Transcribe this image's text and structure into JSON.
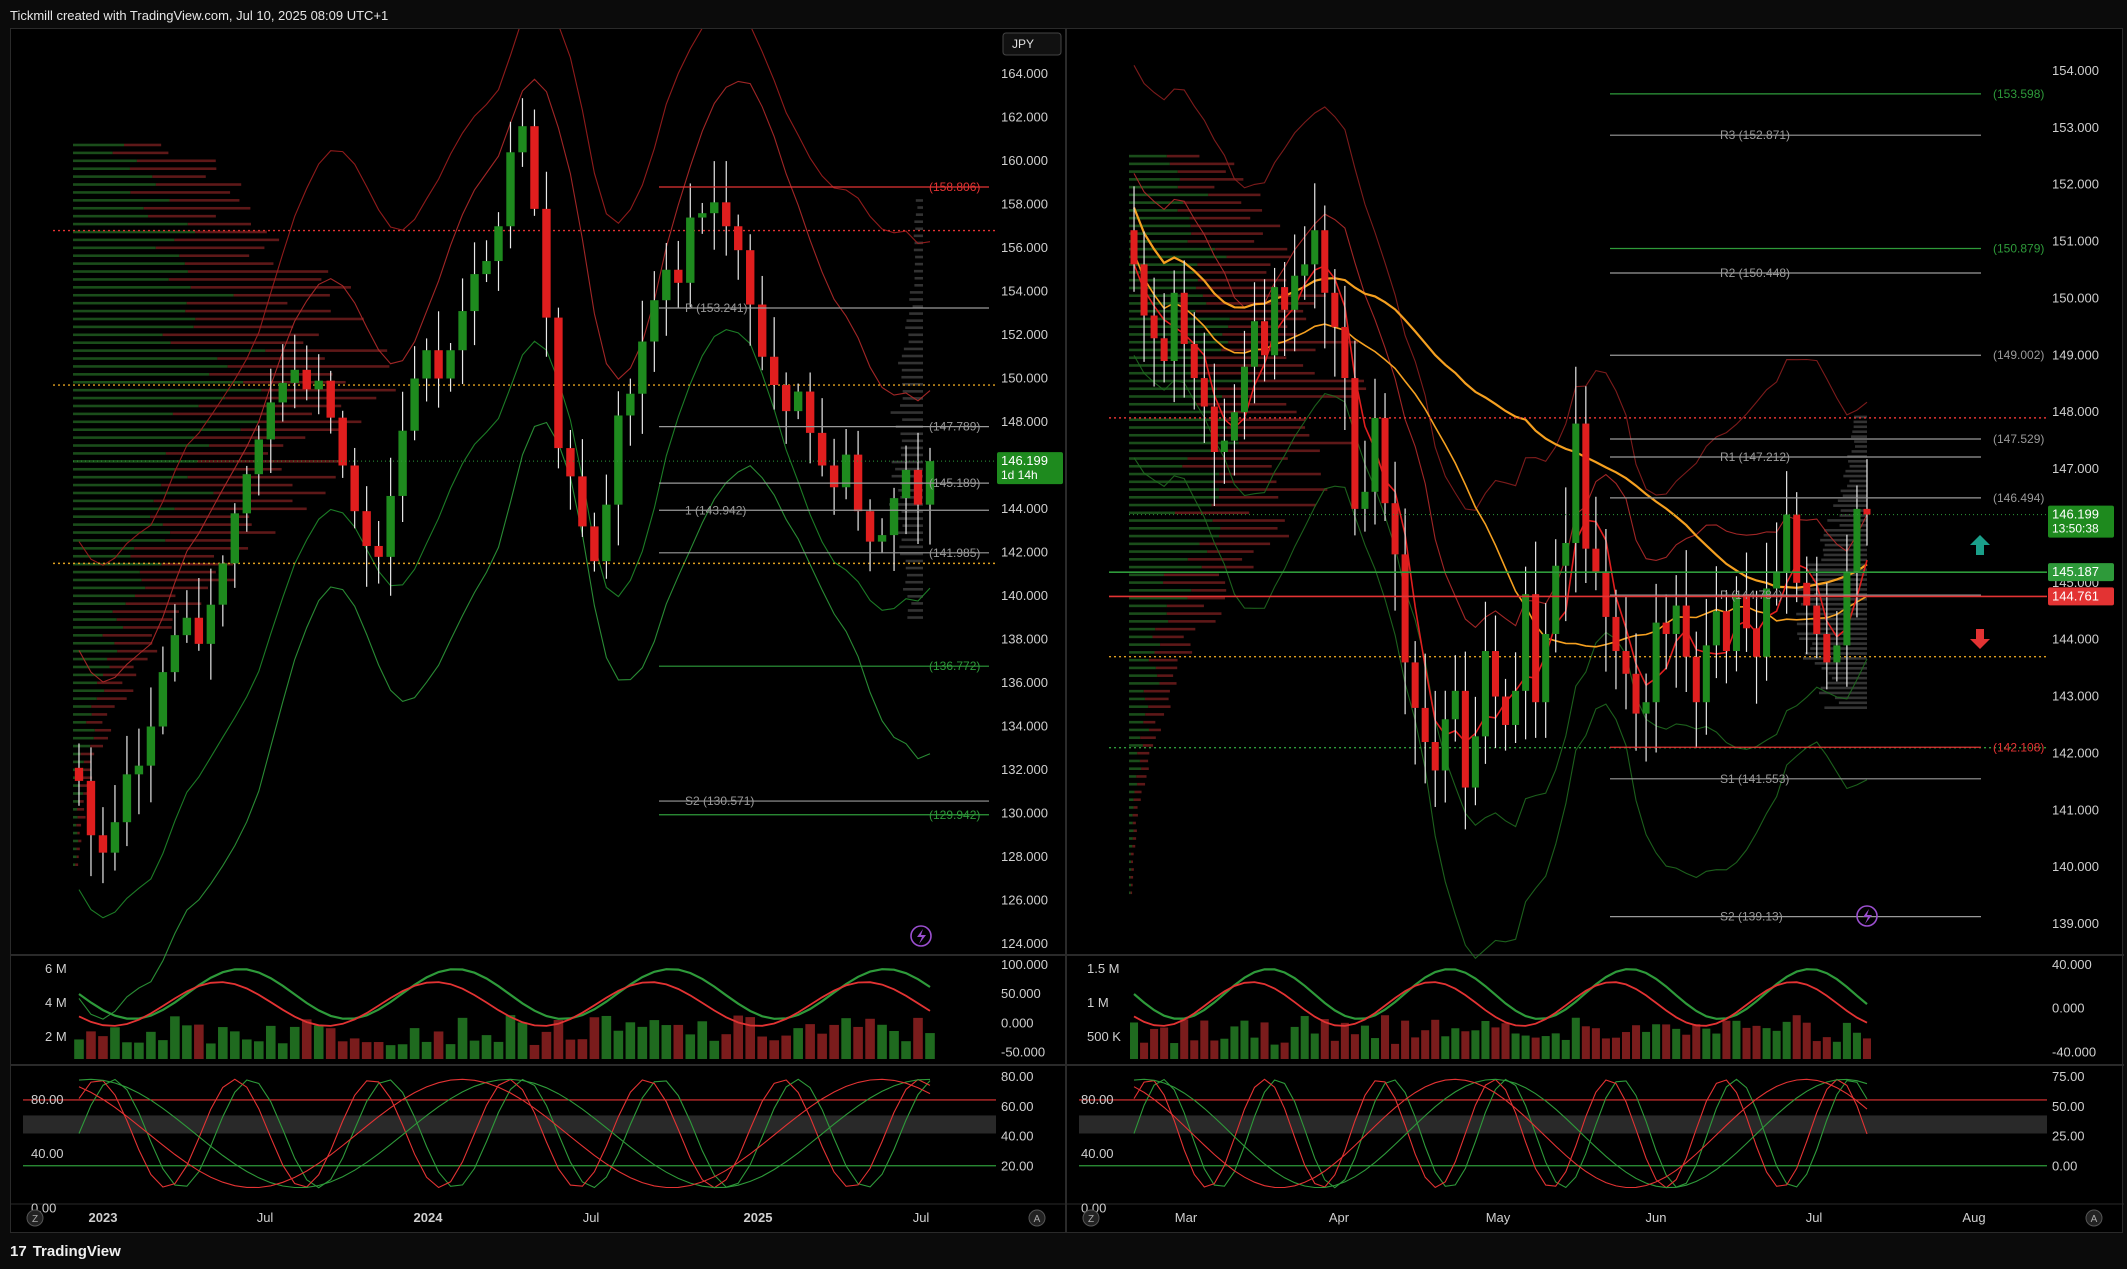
{
  "header": {
    "caption": "Tickmill created with TradingView.com, Jul 10, 2025 08:09 UTC+1"
  },
  "footer": {
    "brand": "TradingView"
  },
  "colors": {
    "up": "#1e8a1e",
    "down": "#e01e1e",
    "background": "#000000",
    "grid": "#1a1a1a",
    "pivot_line": "#9a9a9a",
    "support_green": "#2e9a3a",
    "resistance_red": "#e33333",
    "poc_dotted": "#e0a020",
    "ma_orange": "#f5a020"
  },
  "chart_data": [
    {
      "id": "weekly",
      "type": "candlestick",
      "currency_badge": "JPY",
      "yaxis": {
        "min": 124.0,
        "max": 164.0,
        "ticks": [
          "164.000",
          "162.000",
          "160.000",
          "158.000",
          "156.000",
          "154.000",
          "152.000",
          "150.000",
          "148.000",
          "146.000",
          "144.000",
          "142.000",
          "140.000",
          "138.000",
          "136.000",
          "134.000",
          "132.000",
          "130.000",
          "128.000",
          "126.000",
          "124.000"
        ]
      },
      "xaxis": {
        "ticks": [
          "2023",
          "Jul",
          "2024",
          "Jul",
          "2025",
          "Jul"
        ],
        "bold": [
          "2023",
          "2024",
          "2025"
        ]
      },
      "last_price": {
        "value": "146.199",
        "countdown": "1d 14h"
      },
      "levels": [
        {
          "label": "(158.806)",
          "value": 158.806,
          "kind": "red"
        },
        {
          "label": "P (153.241)",
          "value": 153.241,
          "kind": "pivot"
        },
        {
          "label": "(147.789)",
          "value": 147.789,
          "kind": "pivot"
        },
        {
          "label": "(145.189)",
          "value": 145.189,
          "kind": "pivot"
        },
        {
          "label": "1 (143.942)",
          "value": 143.942,
          "kind": "pivot"
        },
        {
          "label": "(141.985)",
          "value": 141.985,
          "kind": "pivot"
        },
        {
          "label": "(136.772)",
          "value": 136.772,
          "kind": "green"
        },
        {
          "label": "S2 (130.571)",
          "value": 130.571,
          "kind": "pivot"
        },
        {
          "label": "(129.942)",
          "value": 129.942,
          "kind": "green"
        }
      ],
      "horizontal_dotted": [
        {
          "value": 156.8,
          "color": "red"
        },
        {
          "value": 149.7,
          "color": "orange"
        },
        {
          "value": 141.5,
          "color": "orange"
        }
      ],
      "closes": [
        131.5,
        129.0,
        128.2,
        129.6,
        131.8,
        132.2,
        134.0,
        136.5,
        138.2,
        139.0,
        137.8,
        139.6,
        141.5,
        143.8,
        145.6,
        147.2,
        148.9,
        149.8,
        150.4,
        149.5,
        149.9,
        148.2,
        146.0,
        143.9,
        142.3,
        141.8,
        144.6,
        147.6,
        150.0,
        151.3,
        150.0,
        151.3,
        153.1,
        154.8,
        155.4,
        157.0,
        160.4,
        161.6,
        157.8,
        152.8,
        146.8,
        145.5,
        143.2,
        141.6,
        144.2,
        148.3,
        149.3,
        151.7,
        153.6,
        155.0,
        154.4,
        157.4,
        157.6,
        158.1,
        157.0,
        155.9,
        153.4,
        151.0,
        149.7,
        148.5,
        149.4,
        147.5,
        146.0,
        145.0,
        146.5,
        143.9,
        142.5,
        142.8,
        144.5,
        145.8,
        144.2,
        146.2
      ],
      "volume": {
        "ticks": [
          "6 M",
          "4 M",
          "2 M"
        ],
        "osc_ticks": [
          "100.000",
          "50.000",
          "0.000",
          "-50.000"
        ]
      },
      "stochastic": {
        "left_ticks": [
          "80.00",
          "40.00",
          "0.00"
        ],
        "right_ticks": [
          "80.00",
          "60.00",
          "40.00",
          "20.00"
        ]
      }
    },
    {
      "id": "daily",
      "type": "candlestick",
      "yaxis": {
        "min": 139.0,
        "max": 154.0,
        "ticks": [
          "154.000",
          "153.000",
          "152.000",
          "151.000",
          "150.000",
          "149.000",
          "148.000",
          "147.000",
          "146.000",
          "145.000",
          "144.000",
          "143.000",
          "142.000",
          "141.000",
          "140.000",
          "139.000"
        ]
      },
      "xaxis": {
        "ticks": [
          "Mar",
          "Apr",
          "May",
          "Jun",
          "Jul",
          "Aug"
        ]
      },
      "last_price": {
        "value": "146.199",
        "countdown": "13:50:38"
      },
      "price_tags": [
        {
          "value": "145.187",
          "color": "#2e9a3a"
        },
        {
          "value": "144.761",
          "color": "#e33333"
        }
      ],
      "levels": [
        {
          "label": "(153.598)",
          "value": 153.598,
          "kind": "green"
        },
        {
          "label": "R3 (152.871)",
          "value": 152.871,
          "kind": "pivot"
        },
        {
          "label": "(150.879)",
          "value": 150.879,
          "kind": "green"
        },
        {
          "label": "R2 (150.448)",
          "value": 150.448,
          "kind": "pivot"
        },
        {
          "label": "(149.002)",
          "value": 149.002,
          "kind": "pivot"
        },
        {
          "label": "(147.529)",
          "value": 147.529,
          "kind": "pivot"
        },
        {
          "label": "R1 (147.212)",
          "value": 147.212,
          "kind": "pivot"
        },
        {
          "label": "(146.494)",
          "value": 146.494,
          "kind": "pivot"
        },
        {
          "label": "P (144.784)",
          "value": 144.784,
          "kind": "pivot"
        },
        {
          "label": "(142.108)",
          "value": 142.108,
          "kind": "red"
        },
        {
          "label": "S1 (141.553)",
          "value": 141.553,
          "kind": "pivot"
        },
        {
          "label": "S2 (139.13)",
          "value": 139.13,
          "kind": "pivot"
        }
      ],
      "horizontal_dotted": [
        {
          "value": 147.9,
          "color": "red"
        },
        {
          "value": 143.7,
          "color": "orange"
        },
        {
          "value": 142.1,
          "color": "green"
        }
      ],
      "closes": [
        150.6,
        149.7,
        149.3,
        148.9,
        150.1,
        149.2,
        148.6,
        148.1,
        147.3,
        147.5,
        148.0,
        148.8,
        149.6,
        149.0,
        150.2,
        149.8,
        150.4,
        150.6,
        151.2,
        150.1,
        149.5,
        148.6,
        146.3,
        146.6,
        147.9,
        146.4,
        145.5,
        143.6,
        142.8,
        142.2,
        141.7,
        142.6,
        143.1,
        141.4,
        142.3,
        143.8,
        143.0,
        142.5,
        143.1,
        144.8,
        142.9,
        144.1,
        145.3,
        145.7,
        147.8,
        145.6,
        145.2,
        144.4,
        143.8,
        143.4,
        142.7,
        142.9,
        144.3,
        144.1,
        144.6,
        143.7,
        142.9,
        143.9,
        144.5,
        143.8,
        144.8,
        144.2,
        143.7,
        144.9,
        145.2,
        146.2,
        145.0,
        144.6,
        144.1,
        143.6,
        143.9,
        145.2,
        146.3,
        146.2
      ],
      "volume": {
        "ticks": [
          "1.5 M",
          "1 M",
          "500 K"
        ],
        "osc_ticks": [
          "40.000",
          "0.000",
          "-40.000"
        ]
      },
      "stochastic": {
        "left_ticks": [
          "80.00",
          "40.00",
          "0.00"
        ],
        "right_ticks": [
          "75.00",
          "50.00",
          "25.00",
          "0.00"
        ]
      }
    }
  ]
}
